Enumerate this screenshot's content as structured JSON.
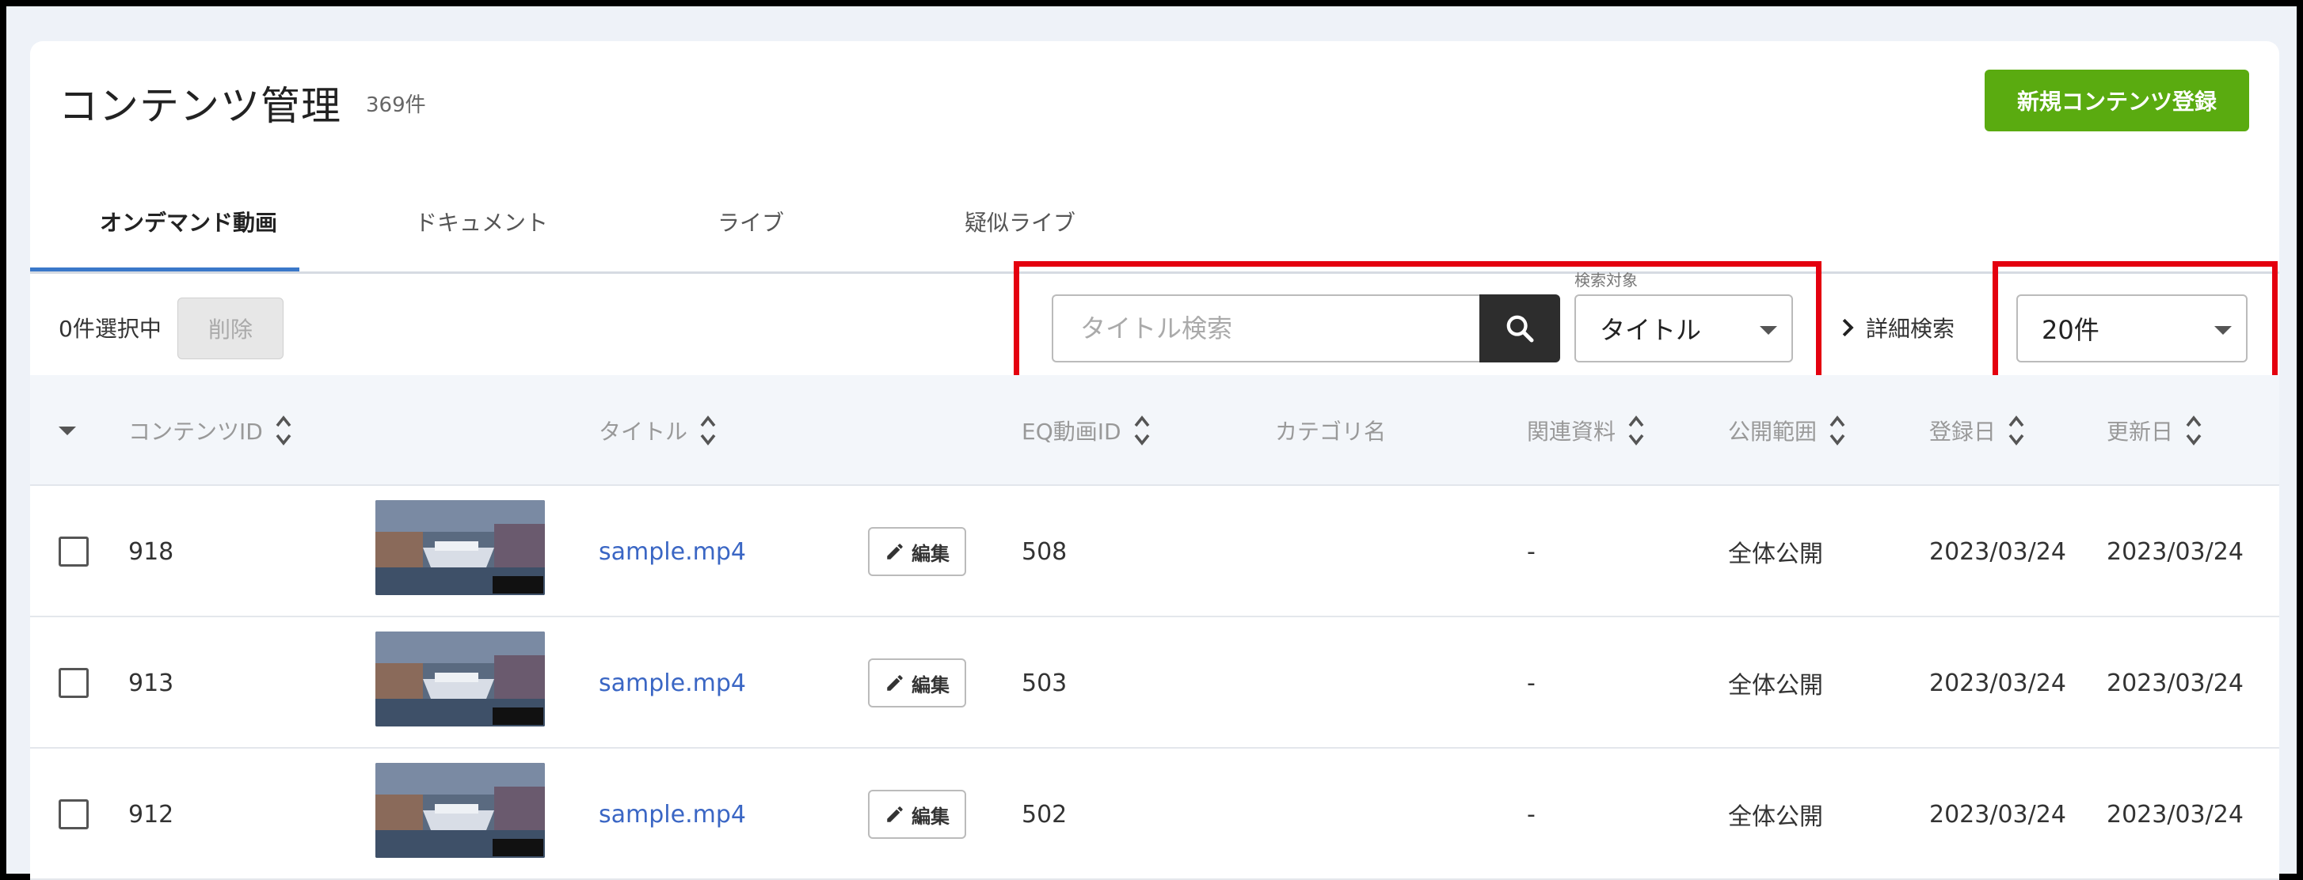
{
  "header": {
    "title": "コンテンツ管理",
    "count": "369件",
    "new_button": "新規コンテンツ登録"
  },
  "tabs": [
    {
      "label": "オンデマンド動画",
      "active": true
    },
    {
      "label": "ドキュメント",
      "active": false
    },
    {
      "label": "ライブ",
      "active": false
    },
    {
      "label": "疑似ライブ",
      "active": false
    }
  ],
  "toolbar": {
    "selected_text": "0件選択中",
    "delete_label": "削除",
    "search_placeholder": "タイトル検索",
    "search_target_label": "検索対象",
    "search_target_value": "タイトル",
    "advanced_search": "詳細検索",
    "per_page": "20件"
  },
  "table": {
    "headers": {
      "content_id": "コンテンツID",
      "title": "タイトル",
      "eq_video_id": "EQ動画ID",
      "category": "カテゴリ名",
      "related": "関連資料",
      "visibility": "公開範囲",
      "registered": "登録日",
      "updated": "更新日"
    },
    "edit_label": "編集",
    "rows": [
      {
        "id": "918",
        "title": "sample.mp4",
        "eq_id": "508",
        "category": "",
        "related": "-",
        "visibility": "全体公開",
        "registered": "2023/03/24",
        "updated": "2023/03/24"
      },
      {
        "id": "913",
        "title": "sample.mp4",
        "eq_id": "503",
        "category": "",
        "related": "-",
        "visibility": "全体公開",
        "registered": "2023/03/24",
        "updated": "2023/03/24"
      },
      {
        "id": "912",
        "title": "sample.mp4",
        "eq_id": "502",
        "category": "",
        "related": "-",
        "visibility": "全体公開",
        "registered": "2023/03/24",
        "updated": "2023/03/24"
      }
    ]
  },
  "colors": {
    "accent": "#5aab10",
    "tab_underline": "#3a78c9",
    "link": "#3a66c4",
    "highlight": "#e4000f"
  }
}
